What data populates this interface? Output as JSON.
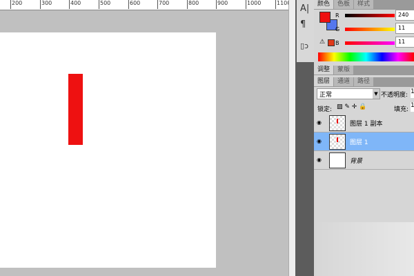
{
  "ruler": {
    "labels": [
      "200",
      "300",
      "400",
      "500",
      "600",
      "700",
      "800",
      "900",
      "1000",
      "1100"
    ]
  },
  "tools": {
    "items": [
      "character-icon",
      "paragraph-icon",
      "clone-source-icon"
    ]
  },
  "color_panel": {
    "tabs": [
      "颜色",
      "色板",
      "样式"
    ],
    "fg": "#ee1111",
    "bg": "#5577ee",
    "r_label": "R",
    "g_label": "G",
    "b_label": "B",
    "r": "240",
    "g": "11",
    "b": "11"
  },
  "adjust_tabs": [
    "调整",
    "蒙版"
  ],
  "layers_panel": {
    "tabs": [
      "图层",
      "通道",
      "路径"
    ],
    "blend_mode": "正常",
    "opacity_label": "不透明度:",
    "opacity": "1",
    "lock_label": "锁定:",
    "fill_label": "填充:",
    "fill": "1",
    "layers": [
      {
        "name": "图层 1 副本",
        "selected": false
      },
      {
        "name": "图层 1",
        "selected": true
      },
      {
        "name": "背景",
        "selected": false
      }
    ]
  }
}
